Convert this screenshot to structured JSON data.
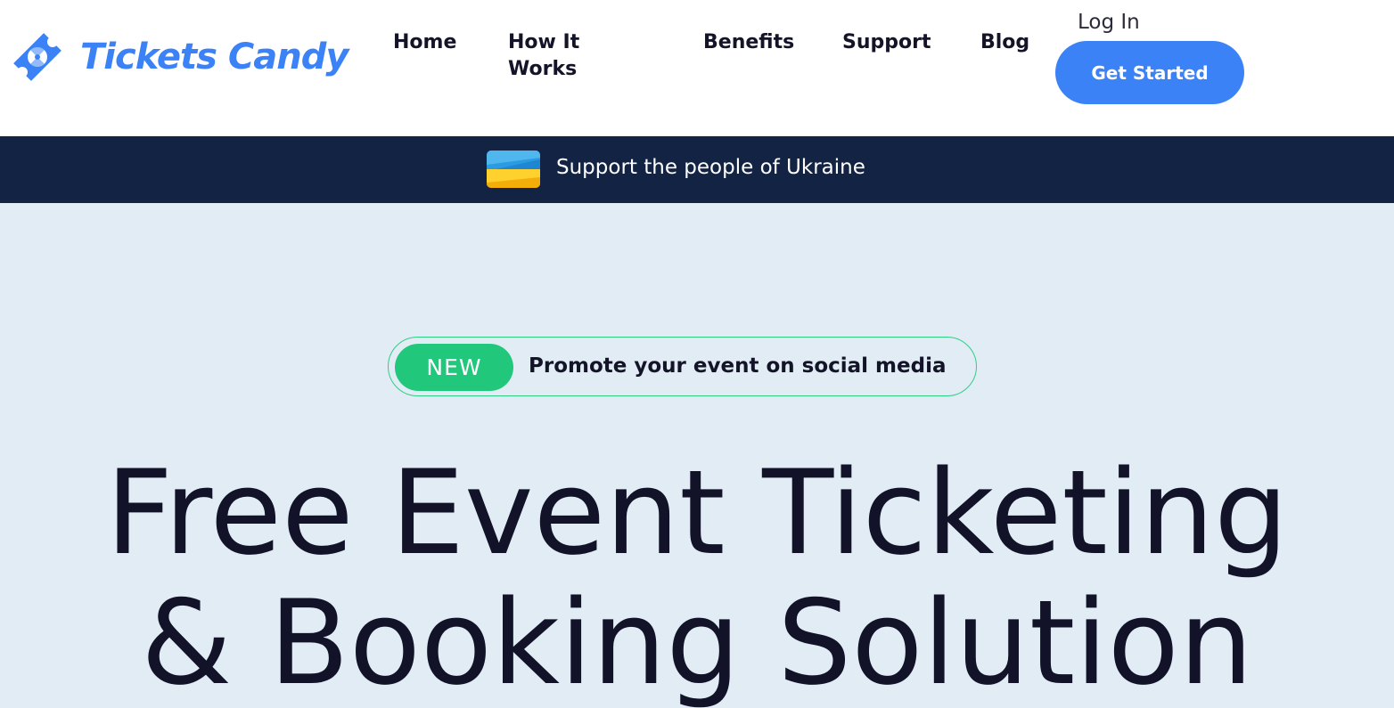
{
  "brand": {
    "name": "Tickets Candy",
    "icon": "ticket-candy-icon",
    "color": "#3b82f6"
  },
  "nav": {
    "items": [
      {
        "label": "Home"
      },
      {
        "label": "How It Works"
      },
      {
        "label": "Benefits"
      },
      {
        "label": "Support"
      },
      {
        "label": "Blog"
      }
    ],
    "login_label": "Log In",
    "cta_label": "Get Started"
  },
  "banner": {
    "text": "Support the people of Ukraine",
    "icon": "ukraine-flag-icon",
    "background": "#132344"
  },
  "hero": {
    "badge": "NEW",
    "badge_text": "Promote your event on social media",
    "title_line1": "Free Event Ticketing",
    "title_line2": "& Booking Solution",
    "background": "#e1ecf5",
    "accent": "#21c87b"
  }
}
